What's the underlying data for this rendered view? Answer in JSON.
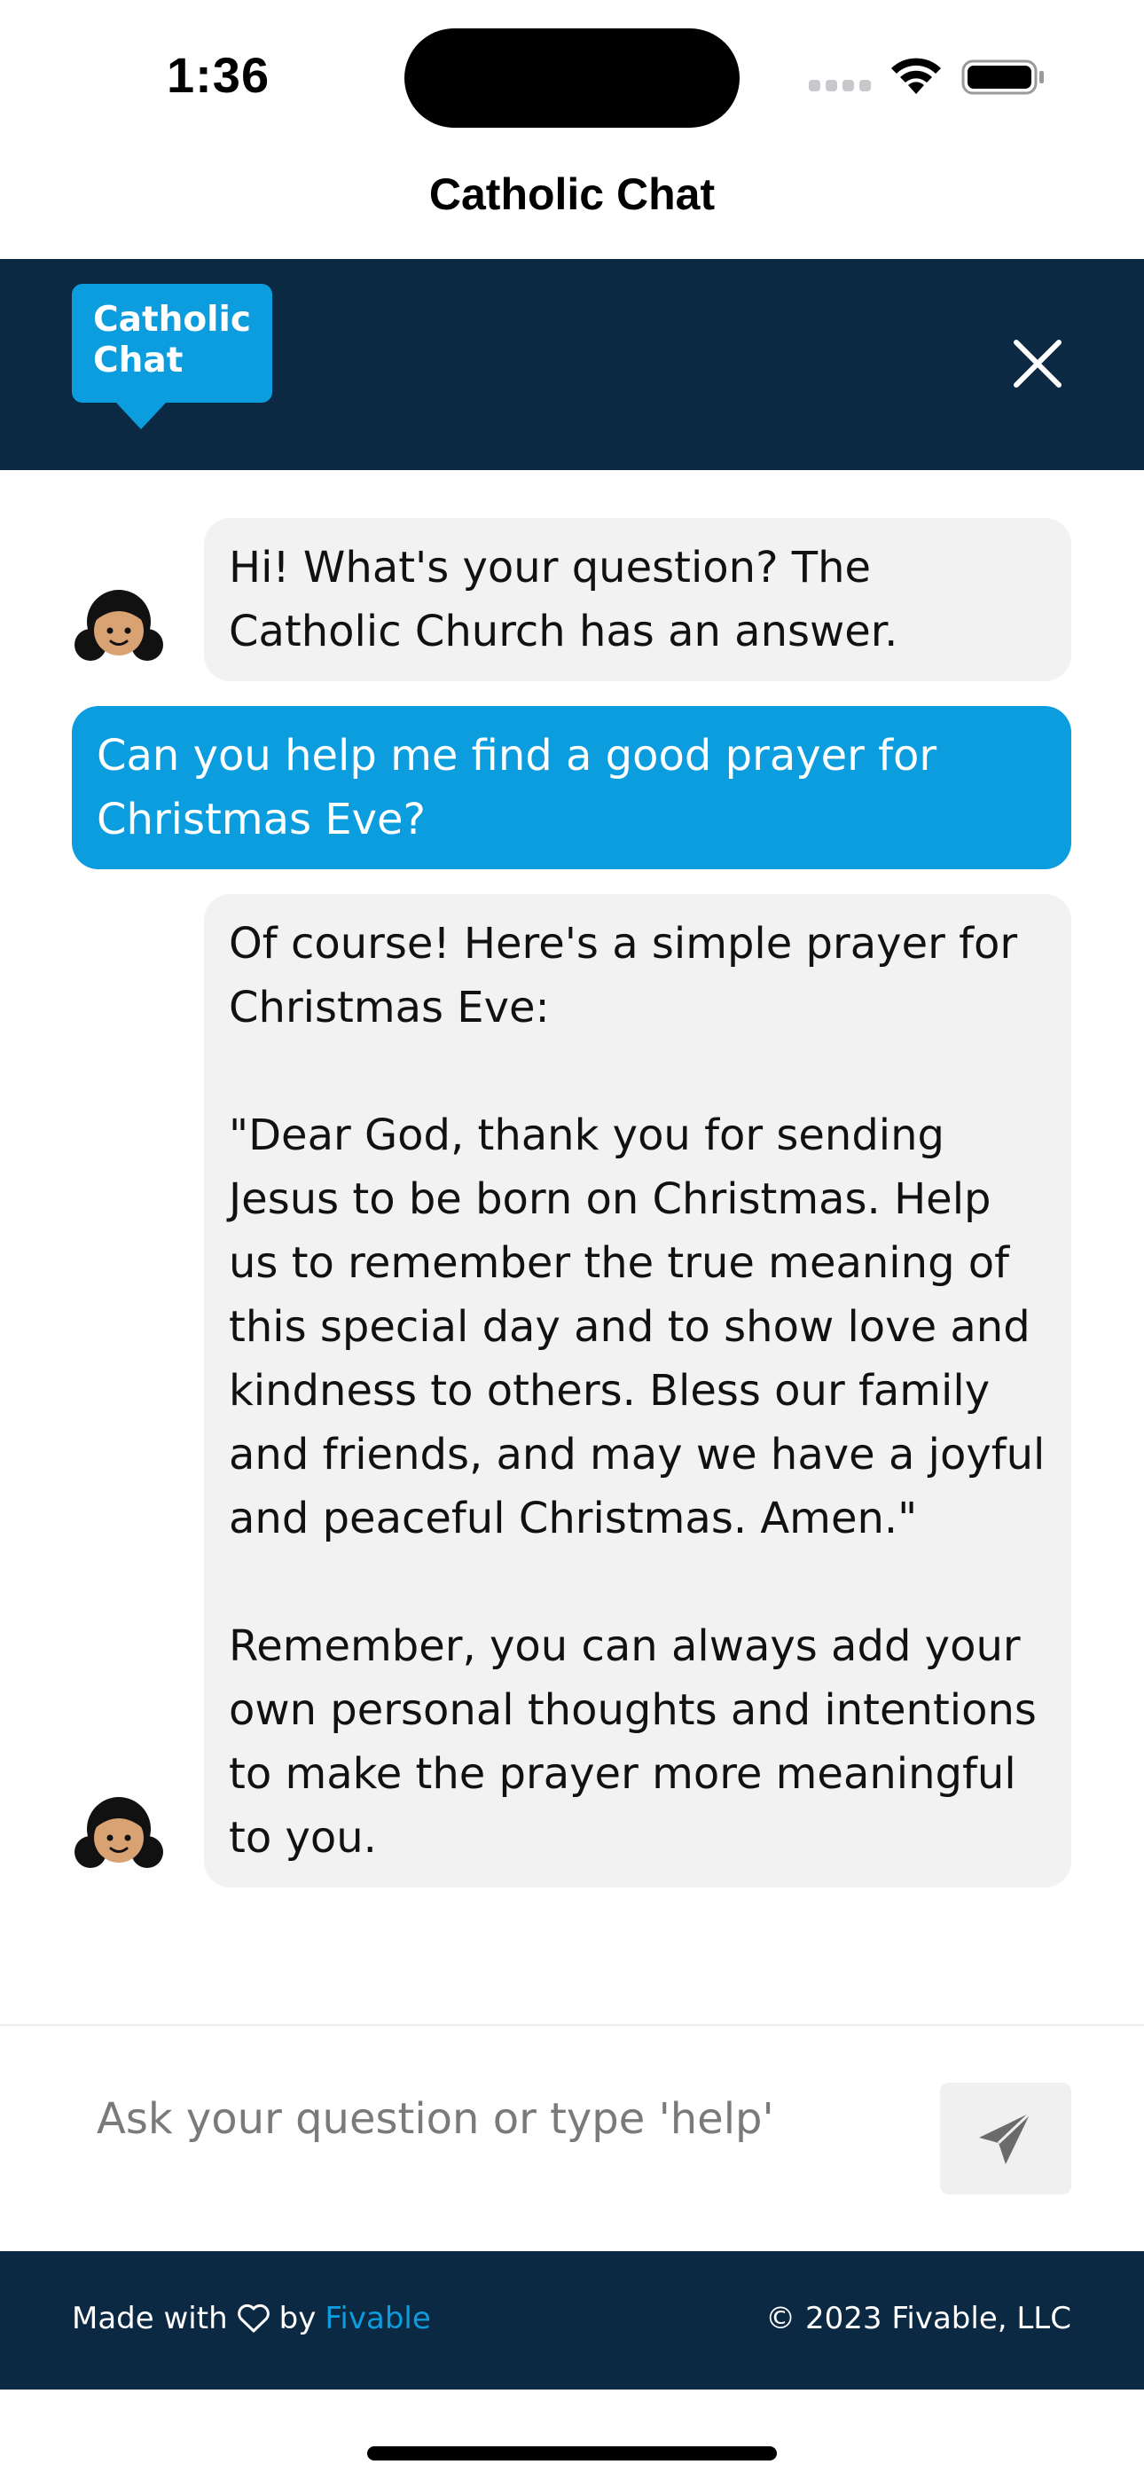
{
  "status_bar": {
    "time": "1:36"
  },
  "nav": {
    "title": "Catholic Chat"
  },
  "header": {
    "logo_text": "Catholic\nChat",
    "close_icon": "close-icon",
    "background_color": "#0b2942",
    "accent_color": "#0c9ddf"
  },
  "messages": [
    {
      "sender": "bot",
      "text": "Hi! What's your question? The Catholic Church has an answer.",
      "avatar_icon": "girl-avatar-icon"
    },
    {
      "sender": "user",
      "text": "Can you help me find a good prayer for Christmas Eve?"
    },
    {
      "sender": "bot",
      "text": "Of course! Here's a simple prayer for Christmas Eve:\n\n\"Dear God, thank you for sending Jesus to be born on Christmas. Help us to remember the true meaning of this special day and to show love and kindness to others. Bless our family and friends, and may we have a joyful and peaceful Christmas. Amen.\"\n\nRemember, you can always add your own personal thoughts and intentions to make the prayer more meaningful to you.",
      "avatar_icon": "girl-avatar-icon"
    }
  ],
  "composer": {
    "placeholder": "Ask your question or type 'help'",
    "value": "",
    "send_icon": "send-icon"
  },
  "footer": {
    "made_with": "Made with",
    "heart_icon": "heart-icon",
    "by": "by",
    "brand_link": "Fivable",
    "copyright": "© 2023 Fivable, LLC"
  }
}
